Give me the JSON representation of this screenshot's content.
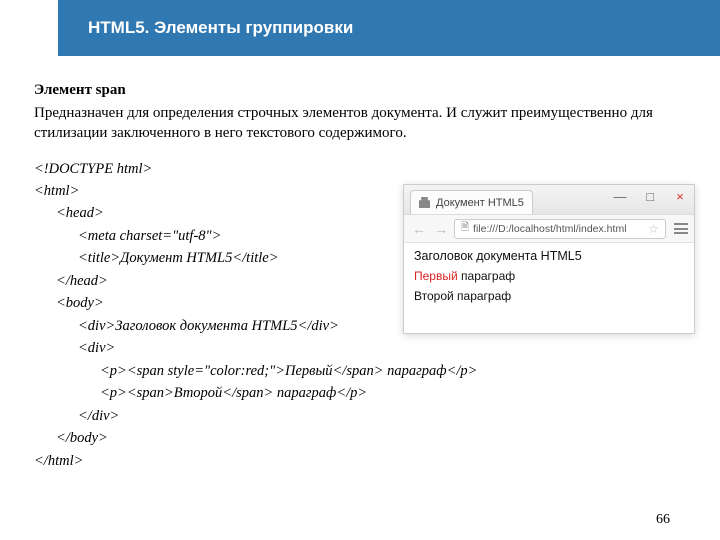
{
  "header": {
    "title": "HTML5. Элементы группировки"
  },
  "section": {
    "title": "Элемент span",
    "description": "Предназначен для определения строчных элементов документа. И служит преимущественно для стилизации заключенного в него текстового содержимого."
  },
  "code": {
    "l01": "<!DOCTYPE html>",
    "l02": "<html>",
    "l03": "<head>",
    "l04": "<meta charset=\"utf-8\">",
    "l05": "<title>Документ HTML5</title>",
    "l06": "</head>",
    "l07": "<body>",
    "l08": "<div>Заголовок документа HTML5</div>",
    "l09": "<div>",
    "l10": "<p><span style=\"color:red;\">Первый</span> параграф</p>",
    "l11": "<p><span>Второй</span> параграф</p>",
    "l12": "</div>",
    "l13": "</body>",
    "l14": "</html>"
  },
  "browser": {
    "tab_title": "Документ HTML5",
    "window": {
      "min": "—",
      "max": "□",
      "close": "×"
    },
    "nav": {
      "back": "←",
      "fwd": "→"
    },
    "address": {
      "scheme_icon": "🗎",
      "url": "file:///D:/localhost/html/index.html",
      "star": "☆"
    },
    "page": {
      "heading": "Заголовок документа HTML5",
      "p1_red": "Первый",
      "p1_rest": " параграф",
      "p2": "Второй параграф"
    }
  },
  "page_number": "66"
}
